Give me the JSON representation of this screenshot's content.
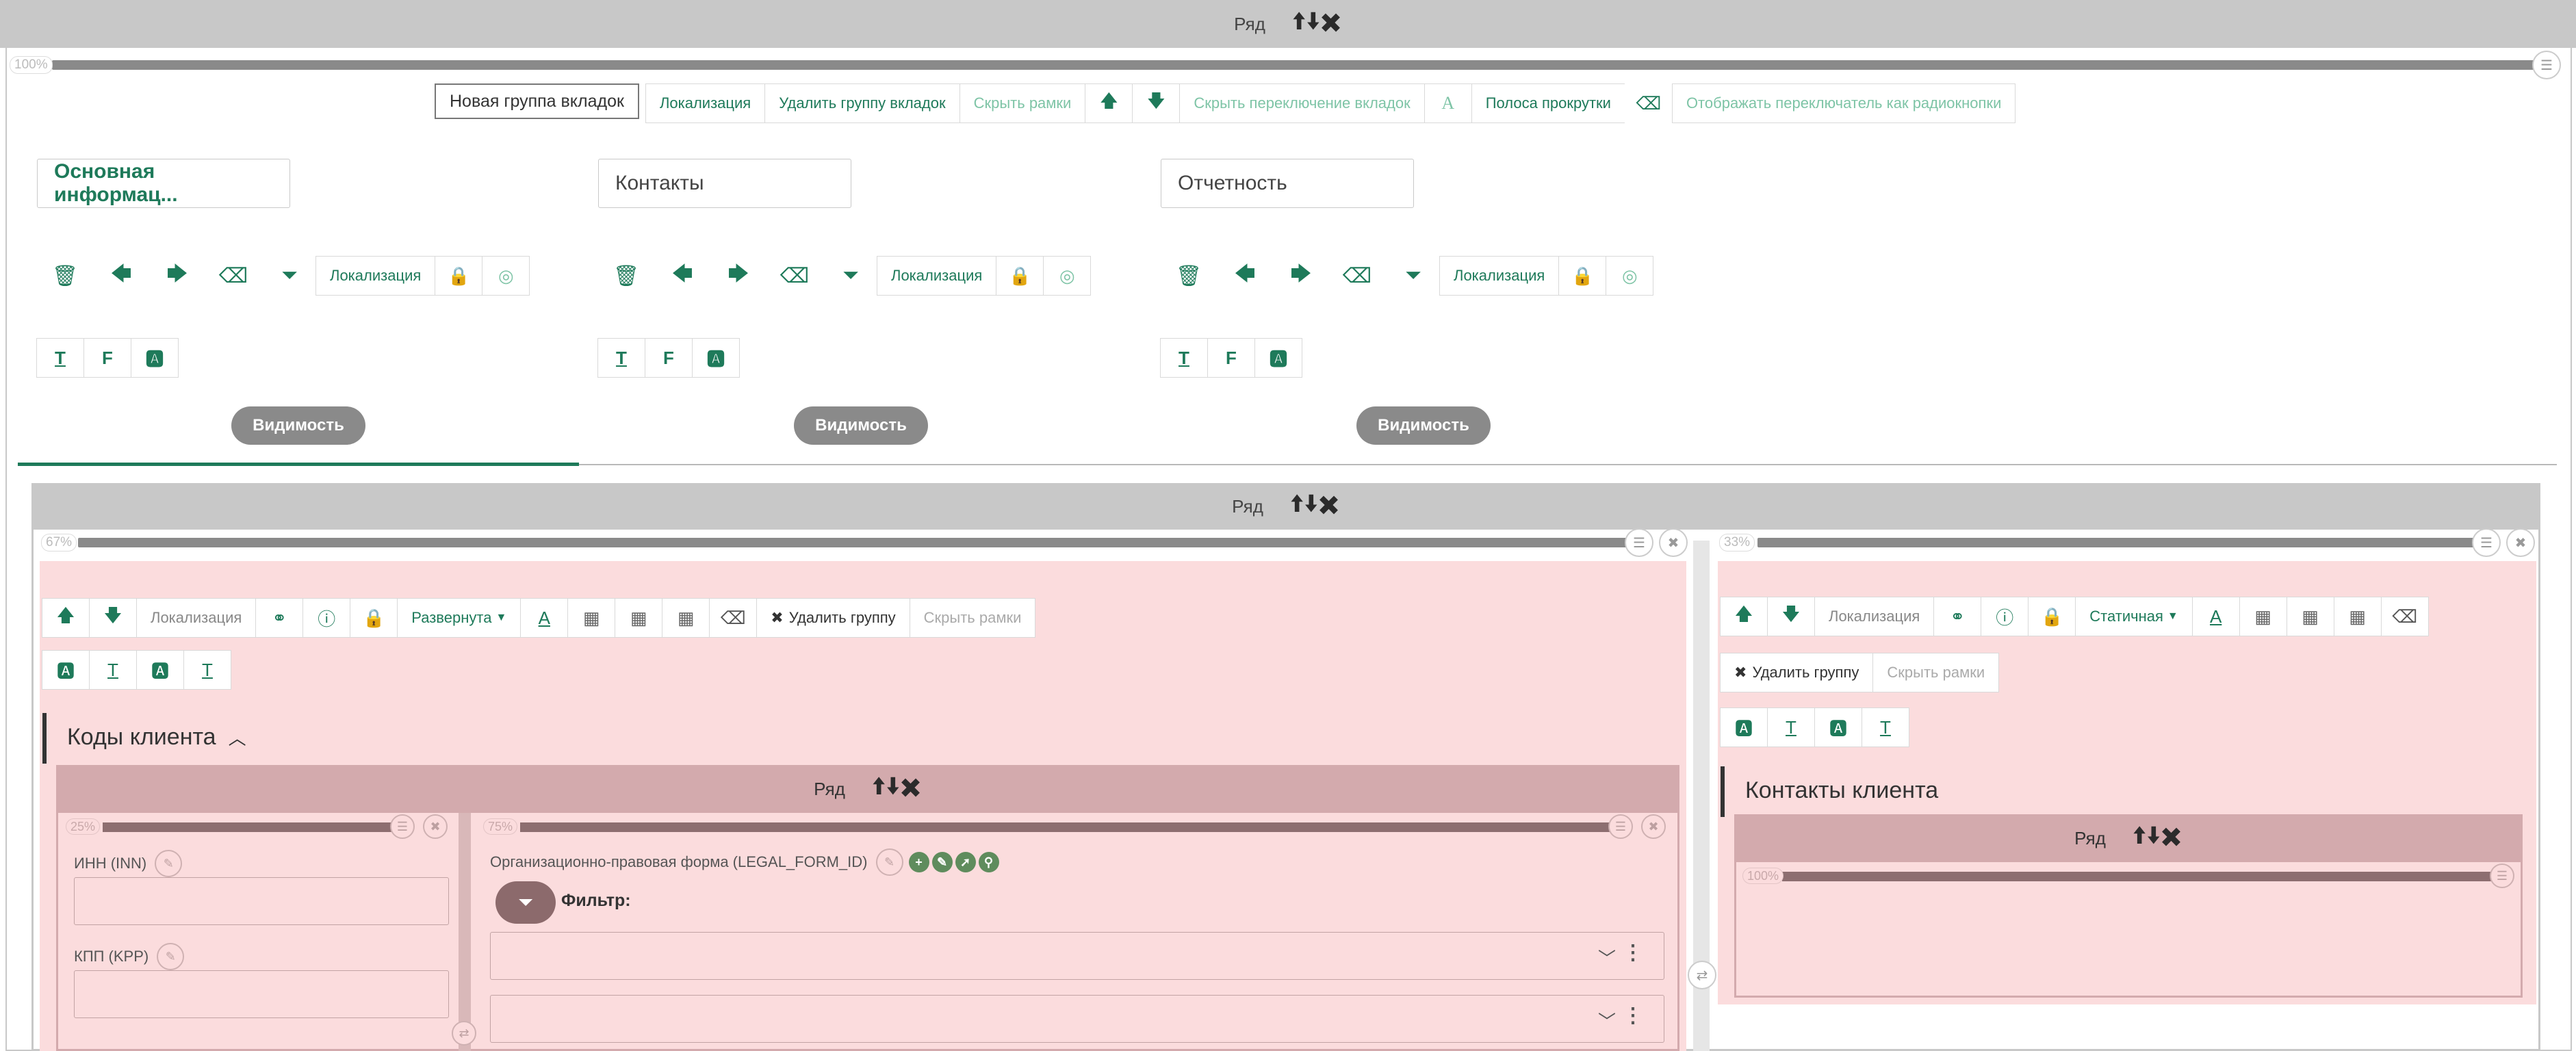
{
  "top_row": {
    "label": "Ряд",
    "arrows": "🠩🠫✖",
    "percent": "100%"
  },
  "tabgroup_toolbar": {
    "new_group": "Новая группа вкладок",
    "localization": "Локализация",
    "delete_group": "Удалить группу вкладок",
    "hide_frames": "Скрыть рамки",
    "hide_tab_switch": "Скрыть переключение вкладок",
    "scrollbar": "Полоса прокрутки",
    "radio_switch": "Отображать переключатель как радиокнопки"
  },
  "tabs": [
    {
      "title": "Основная информац...",
      "localization": "Локализация",
      "visibility": "Видимость"
    },
    {
      "title": "Контакты",
      "localization": "Локализация",
      "visibility": "Видимость"
    },
    {
      "title": "Отчетность",
      "localization": "Локализация",
      "visibility": "Видимость"
    }
  ],
  "section_row": {
    "label": "Ряд",
    "arrows": "🠩🠫✖"
  },
  "left_col": {
    "percent": "67%",
    "toolbar": {
      "localization": "Локализация",
      "mode": "Развернута",
      "delete_group": "Удалить группу",
      "hide_frames": "Скрыть рамки"
    },
    "group_title": "Коды клиента",
    "inner_row": {
      "label": "Ряд",
      "arrows": "🠩🠫✖"
    },
    "sub_left": {
      "percent": "25%",
      "field1_label": "ИНН (INN)",
      "field2_label": "КПП (KPP)"
    },
    "sub_right": {
      "percent": "75%",
      "field_label": "Организационно-правовая форма (LEGAL_FORM_ID)",
      "filter_label": "Фильтр:"
    }
  },
  "right_col": {
    "percent": "33%",
    "toolbar": {
      "localization": "Локализация",
      "mode": "Статичная",
      "delete_group": "Удалить группу",
      "hide_frames": "Скрыть рамки"
    },
    "group_title": "Контакты клиента",
    "inner_row": {
      "label": "Ряд",
      "arrows": "🠩🠫✖",
      "percent": "100%"
    }
  }
}
